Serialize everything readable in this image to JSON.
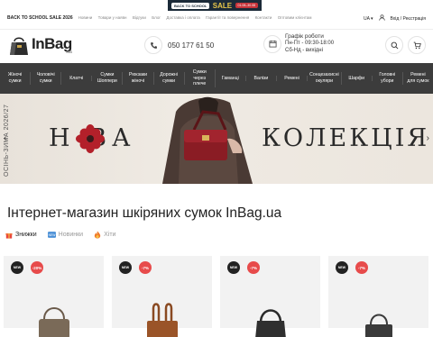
{
  "topbar": {
    "sale": "BACK TO SCHOOL SALE 2026",
    "nav": [
      "Новини",
      "Товари у наявн",
      "Відгуки",
      "Блог",
      "Доставка і оплата",
      "Гарантії та повернення",
      "Контакти",
      "Оптовим клієнтам"
    ],
    "promo": {
      "tag": "BACK TO SCHOOL",
      "sale": "SALE",
      "dates": "01.08–30.08"
    },
    "lang": "UA",
    "login": "Вхід / Реєстрація"
  },
  "header": {
    "logo_text": "InBag",
    "logo_domain": ".ua",
    "phone": "050 177 61 50",
    "schedule_title": "Графік роботи",
    "schedule_weekdays": "Пн-Пт - 09:30-18:00",
    "schedule_weekend": "Сб-Нд - вихідні"
  },
  "categories": [
    {
      "l1": "Жіночі",
      "l2": "сумки"
    },
    {
      "l1": "Чоловічі",
      "l2": "сумки"
    },
    {
      "l1": "Клатчі",
      "l2": ""
    },
    {
      "l1": "Сумки",
      "l2": "Шоппери"
    },
    {
      "l1": "Рюкзаки",
      "l2": "жіночі"
    },
    {
      "l1": "Дорожні",
      "l2": "сумки"
    },
    {
      "l1": "Сумки",
      "l2": "через плече"
    },
    {
      "l1": "Гаманці",
      "l2": ""
    },
    {
      "l1": "Валізи",
      "l2": ""
    },
    {
      "l1": "Ремені",
      "l2": ""
    },
    {
      "l1": "Сонцезахисні",
      "l2": "окуляри"
    },
    {
      "l1": "Шарфи",
      "l2": ""
    },
    {
      "l1": "Головні",
      "l2": "убори"
    },
    {
      "l1": "Ремені",
      "l2": "для сумок"
    }
  ],
  "hero": {
    "vertical": "ОСІНЬ-ЗИМА 2026/27",
    "word1": "Н  ВА",
    "word2": "КОЛЕКЦІЯ"
  },
  "main": {
    "title": "Інтернет-магазин шкіряних сумок InBag.ua",
    "tabs": [
      {
        "icon": "gift-icon",
        "label": "Знижки"
      },
      {
        "icon": "new-icon",
        "label": "Новинки"
      },
      {
        "icon": "fire-icon",
        "label": "Хіти"
      }
    ]
  },
  "products": [
    {
      "new": "NEW",
      "discount": "-20%"
    },
    {
      "new": "NEW",
      "discount": "-7%"
    },
    {
      "new": "NEW",
      "discount": "-7%"
    },
    {
      "new": "NEW",
      "discount": "-7%"
    }
  ],
  "colors": {
    "nav_bg": "#3c3c3c",
    "badge_red": "#e74b4b",
    "badge_dark": "#222222"
  }
}
